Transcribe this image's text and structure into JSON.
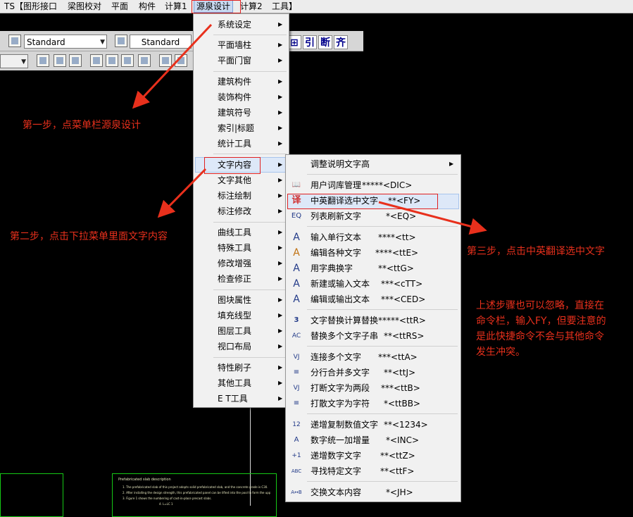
{
  "menubar": {
    "items": [
      {
        "label": "TS【图形接口",
        "active": false
      },
      {
        "label": "梁图校对",
        "active": false
      },
      {
        "label": "平面",
        "active": false
      },
      {
        "label": "构件",
        "active": false
      },
      {
        "label": "计算1",
        "active": false
      },
      {
        "label": "源泉设计",
        "active": true
      },
      {
        "label": "计算2",
        "active": false
      },
      {
        "label": "工具】",
        "active": false
      }
    ]
  },
  "toolbar": {
    "combo1": "Standard",
    "combo2": "Standard",
    "chars": [
      "引",
      "断",
      "齐"
    ]
  },
  "main_menu": {
    "items": [
      {
        "label": "系统设定"
      },
      {
        "label": "平面墙柱"
      },
      {
        "label": "平面门窗"
      },
      {
        "label": "建筑构件"
      },
      {
        "label": "装饰构件"
      },
      {
        "label": "建筑符号"
      },
      {
        "label": "索引|标题"
      },
      {
        "label": "统计工具"
      },
      {
        "label": "文字内容"
      },
      {
        "label": "文字其他"
      },
      {
        "label": "标注绘制"
      },
      {
        "label": "标注修改"
      },
      {
        "label": "曲线工具"
      },
      {
        "label": "特殊工具"
      },
      {
        "label": "修改增强"
      },
      {
        "label": "检查修正"
      },
      {
        "label": "图块属性"
      },
      {
        "label": "填充线型"
      },
      {
        "label": "图层工具"
      },
      {
        "label": "视口布局"
      },
      {
        "label": "特性刷子"
      },
      {
        "label": "其他工具"
      },
      {
        "label": "E T工具"
      }
    ]
  },
  "sub_menu": {
    "items": [
      {
        "label": "调整说明文字高",
        "shortcut": "",
        "icon": ""
      },
      {
        "label": "用户词库管理",
        "shortcut": "*****<DIC>",
        "icon": "📖"
      },
      {
        "label": "中英翻译选中文字",
        "shortcut": "**<FY>",
        "icon": "译"
      },
      {
        "label": "列表刷新文字",
        "shortcut": "*<EQ>",
        "icon": "EQ"
      },
      {
        "label": "输入单行文本",
        "shortcut": "****<tt>",
        "icon": "A"
      },
      {
        "label": "编辑各种文字",
        "shortcut": "****<ttE>",
        "icon": "A"
      },
      {
        "label": "用字典换字",
        "shortcut": "**<ttG>",
        "icon": "A"
      },
      {
        "label": "新建或输入文本",
        "shortcut": "***<cTT>",
        "icon": "A"
      },
      {
        "label": "编辑或输出文本",
        "shortcut": "***<CED>",
        "icon": "A"
      },
      {
        "label": "文字替换计算替换",
        "shortcut": "*****<ttR>",
        "icon": "3"
      },
      {
        "label": "替换多个文字子串",
        "shortcut": "**<ttRS>",
        "icon": "AC"
      },
      {
        "label": "连接多个文字",
        "shortcut": "***<ttA>",
        "icon": "VJ"
      },
      {
        "label": "分行合并多文字",
        "shortcut": "**<ttJ>",
        "icon": "≡"
      },
      {
        "label": "打断文字为两段",
        "shortcut": "***<ttB>",
        "icon": "VJ"
      },
      {
        "label": "打散文字为字符",
        "shortcut": "*<ttBB>",
        "icon": "≡"
      },
      {
        "label": "递增复制数值文字",
        "shortcut": "**<1234>",
        "icon": "12"
      },
      {
        "label": "数字统一加增量",
        "shortcut": "*<INC>",
        "icon": "A"
      },
      {
        "label": "递增数字文字",
        "shortcut": "**<ttZ>",
        "icon": "+1"
      },
      {
        "label": "寻找特定文字",
        "shortcut": "**<ttF>",
        "icon": "ABC"
      },
      {
        "label": "交换文本内容",
        "shortcut": "*<JH>",
        "icon": "A↔B"
      }
    ]
  },
  "annotations": {
    "step1": "第一步，点菜单栏源泉设计",
    "step2": "第二步，点击下拉菜单里面文字内容",
    "step3": "第三步，点击中英翻译选中文字",
    "note": [
      "上述步骤也可以忽略，直接在",
      "命令栏，输入FY，但要注意的",
      "是此快捷命令不会与其他命令",
      "发生冲突。"
    ]
  },
  "drawing_note": {
    "title": "Prefabricated slab description",
    "lines": [
      "1. The prefabricated slab of this project adopts solid prefabricated slab, and the concrete grade is C30.",
      "2. After installing the design strength, this prefabricated panel can be lifted into the pool to form the upper and groove.",
      "3. Figure 1 shows the numbering of cast-in-place precast slabs.",
      "4. L=LC    1"
    ]
  },
  "colors": {
    "annotation": "#e8301c",
    "highlight": "#dde8f8",
    "green": "#16c816"
  }
}
